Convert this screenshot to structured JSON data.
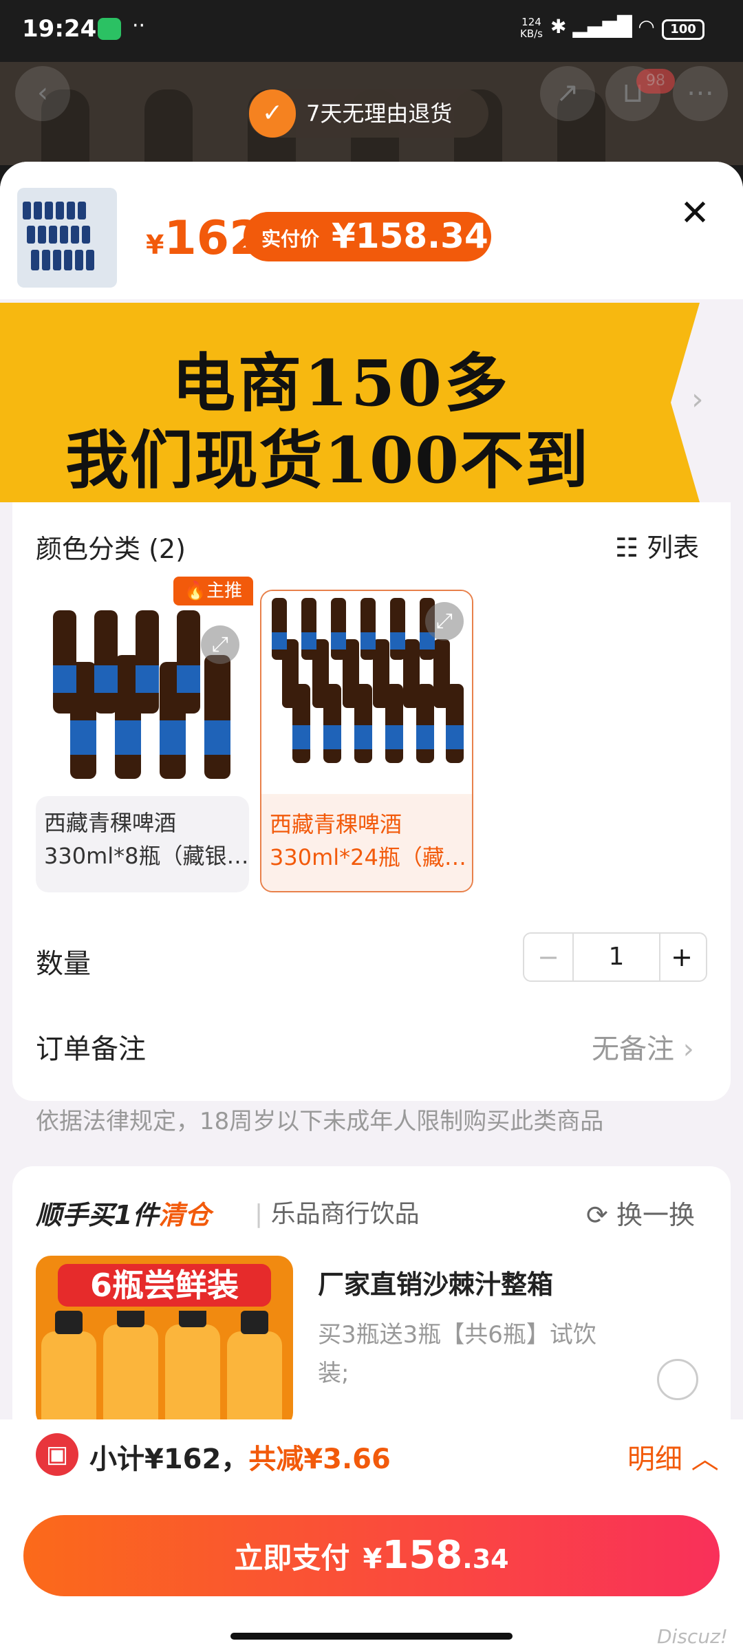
{
  "status_bar": {
    "time": "19:24",
    "net_speed_value": "124",
    "net_speed_unit": "KB/s",
    "battery": "100"
  },
  "top": {
    "return_policy": "7天无理由退货",
    "cart_count": "98"
  },
  "header": {
    "currency": "¥",
    "price": "162",
    "paid_label": "实付价",
    "paid_price": "¥158.34"
  },
  "banner": {
    "line1": "电商150多",
    "line2": "我们现货100不到"
  },
  "variants": {
    "title": "颜色分类 (2)",
    "list_view": "列表",
    "hot_tag": "主推",
    "items": [
      {
        "line1": "西藏青稞啤酒",
        "line2": "330ml*8瓶（藏银…",
        "selected": false
      },
      {
        "line1": "西藏青稞啤酒",
        "line2": "330ml*24瓶（藏…",
        "selected": true
      }
    ]
  },
  "quantity": {
    "label": "数量",
    "minus": "−",
    "value": "1",
    "plus": "+"
  },
  "order_note": {
    "label": "订单备注",
    "value": "无备注"
  },
  "legal_notice": "依据法律规定，18周岁以下未成年人限制购买此类商品",
  "addon": {
    "title_prefix": "顺手买1件",
    "title_tag": "清仓",
    "shop": "乐品商行饮品",
    "swap": "换一换",
    "product_badge": "6瓶尝鲜装",
    "product_title": "厂家直销沙棘汁整箱",
    "product_desc": "买3瓶送3瓶【共6瓶】试饮装;"
  },
  "footer": {
    "subtotal": "小计¥162，",
    "discount": "共减¥3.66",
    "detail": "明细",
    "pay_label": "立即支付",
    "pay_currency": "¥",
    "pay_int": "158",
    "pay_dec": ".34"
  },
  "watermark": "Discuz!"
}
